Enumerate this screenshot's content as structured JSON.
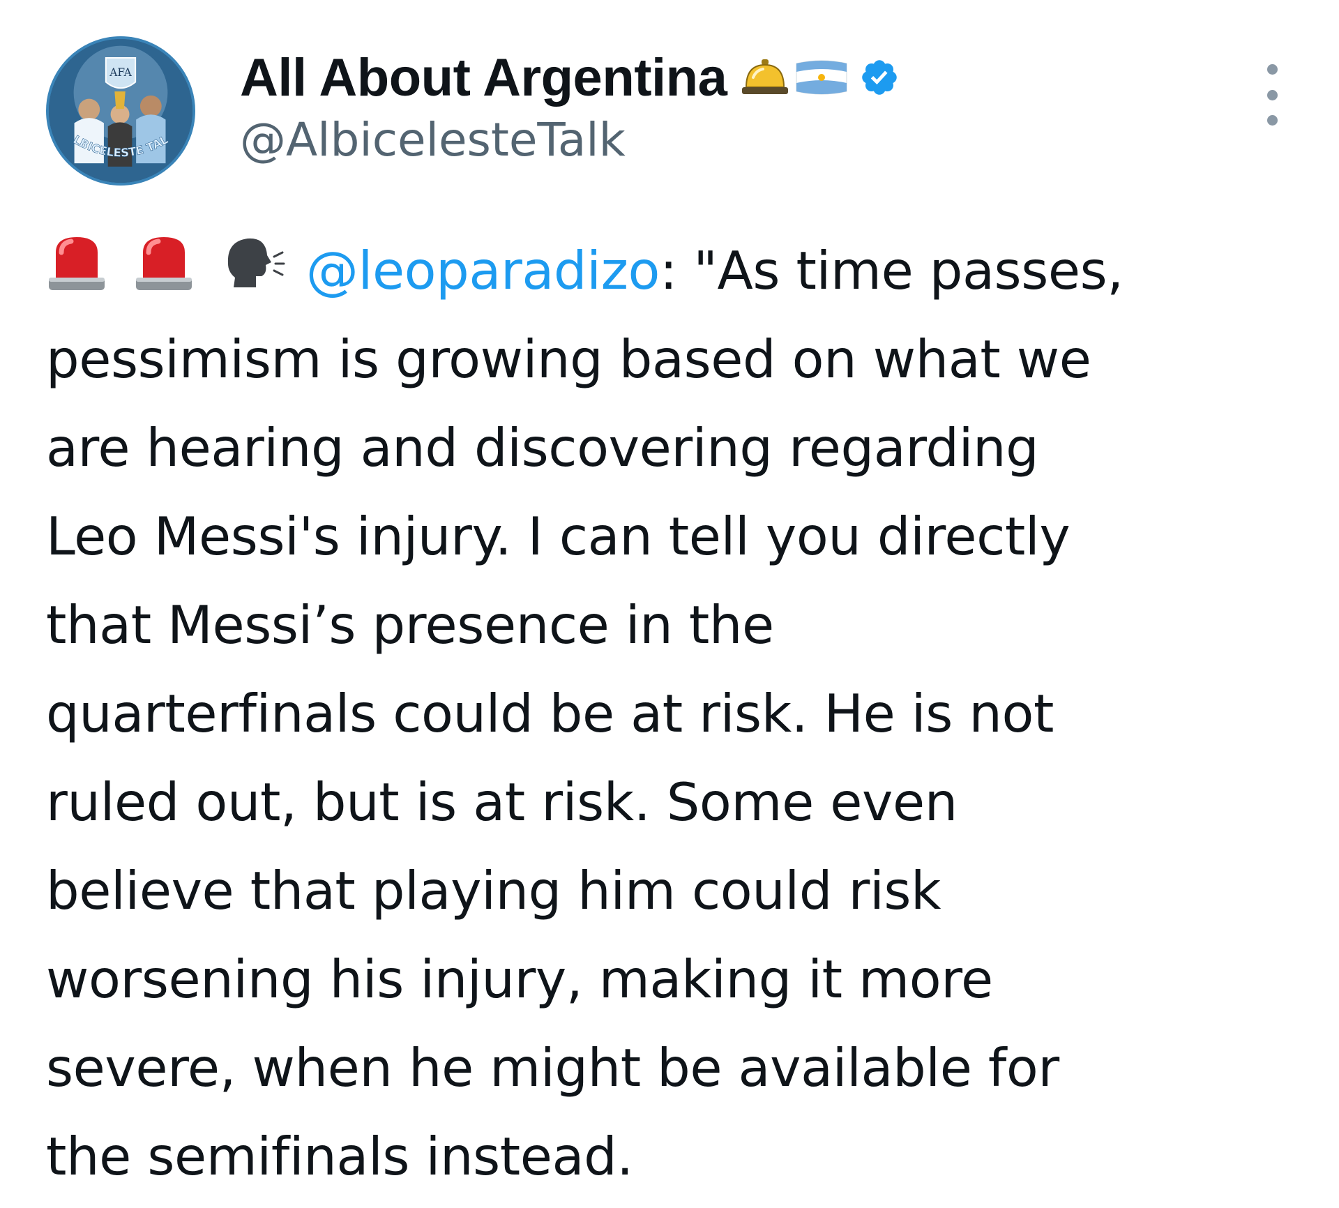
{
  "author": {
    "display_name": "All About Argentina",
    "handle": "@Albiceleste​Talk",
    "verified": true,
    "name_emojis": [
      "bellhop-bell-icon",
      "argentina-flag-icon",
      "verified-badge-icon"
    ],
    "avatar_text": "ALBICELESTE TALK",
    "avatar_crest": "AFA"
  },
  "menu": {
    "icon": "more-options-icon"
  },
  "tweet": {
    "lead_emojis": [
      "police-light-icon",
      "police-light-icon",
      "speaking-head-icon"
    ],
    "mention": "@leoparadizo",
    "lines": [
      ": \"As time passes,",
      "pessimism is growing based on what we",
      "are hearing and discovering regarding",
      "Leo Messi's injury. I can tell you directly",
      "that Messi’s presence in the",
      "quarterfinals could be at risk. He is not",
      "ruled out, but is at risk. Some even",
      "believe that playing him could risk",
      "worsening his injury, making it more",
      "severe, when he might be available for",
      "the semifinals instead."
    ]
  },
  "colors": {
    "text": "#0f1419",
    "secondary": "#536471",
    "link": "#1d9bf0",
    "verified": "#1d9bf0",
    "siren_red": "#d81f26"
  }
}
